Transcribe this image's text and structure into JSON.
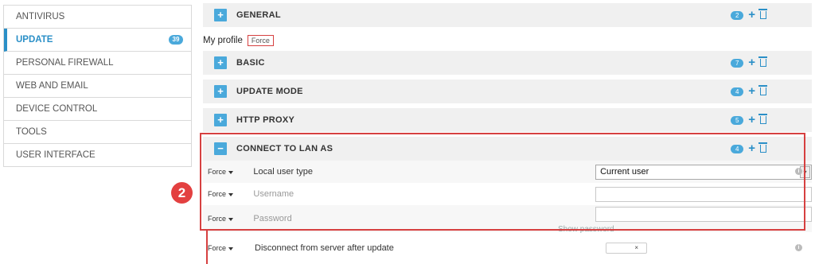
{
  "sidebar": {
    "items": [
      {
        "label": "ANTIVIRUS"
      },
      {
        "label": "UPDATE",
        "badge": "39"
      },
      {
        "label": "PERSONAL FIREWALL"
      },
      {
        "label": "WEB AND EMAIL"
      },
      {
        "label": "DEVICE CONTROL"
      },
      {
        "label": "TOOLS"
      },
      {
        "label": "USER INTERFACE"
      }
    ]
  },
  "sections": {
    "general": {
      "title": "GENERAL",
      "badge": "2"
    },
    "basic": {
      "title": "BASIC",
      "badge": "7"
    },
    "update_mode": {
      "title": "UPDATE MODE",
      "badge": "4"
    },
    "http_proxy": {
      "title": "HTTP PROXY",
      "badge": "5"
    },
    "connect_lan": {
      "title": "CONNECT TO LAN AS",
      "badge": "4"
    }
  },
  "profile": {
    "label": "My profile",
    "force": "Force"
  },
  "rows": {
    "local_user_type": {
      "force": "Force",
      "label": "Local user type",
      "value": "Current user"
    },
    "username": {
      "force": "Force",
      "label": "Username",
      "value": ""
    },
    "password": {
      "force": "Force",
      "label": "Password",
      "value": ""
    },
    "show_password": "Show password",
    "disconnect": {
      "force": "Force",
      "label": "Disconnect from server after update",
      "toggle": "×"
    }
  },
  "callout": "2",
  "icons": {
    "plus": "+",
    "minus": "−",
    "info": "i",
    "dropdown_arrow": "▾"
  },
  "colors": {
    "accent": "#4aa9db",
    "highlight": "#d64040"
  }
}
